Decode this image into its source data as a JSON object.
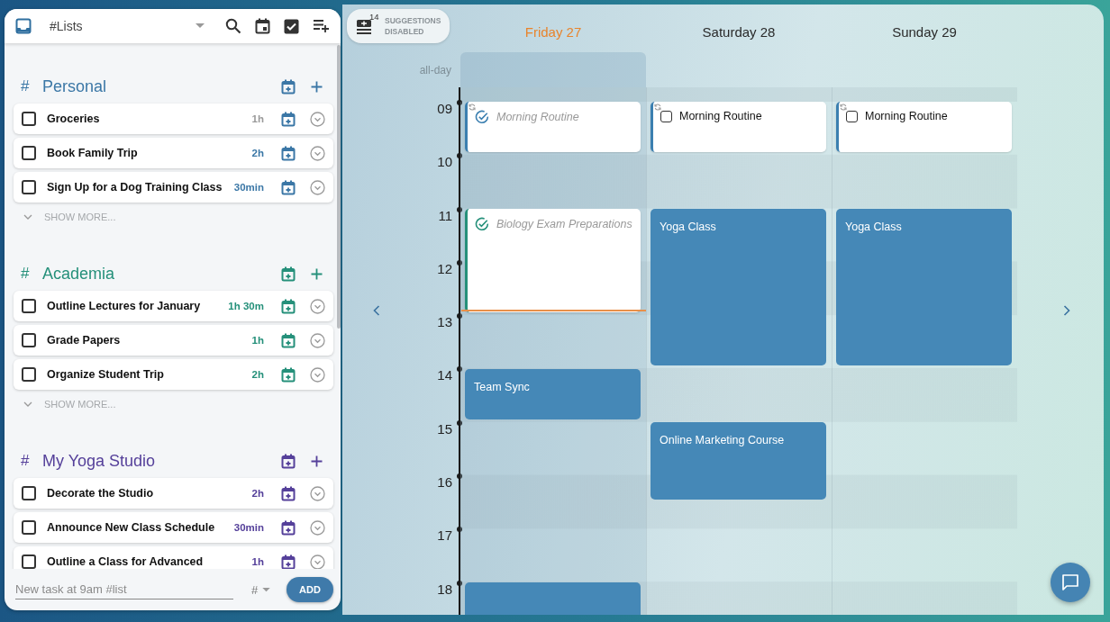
{
  "list_panel": {
    "title": "#Lists",
    "sections": [
      {
        "marker": "#",
        "name": "Personal",
        "color": "#3b77a6",
        "show_more": "SHOW MORE...",
        "tasks": [
          {
            "title": "Groceries",
            "duration": "1h",
            "duration_muted": true,
            "checked": false
          },
          {
            "title": "Book Family Trip",
            "duration": "2h",
            "duration_muted": false,
            "checked": false
          },
          {
            "title": "Sign Up for a Dog Training Class",
            "duration": "30min",
            "duration_muted": false,
            "checked": false
          }
        ]
      },
      {
        "marker": "#",
        "name": "Academia",
        "color": "#25907a",
        "show_more": "SHOW MORE...",
        "tasks": [
          {
            "title": "Outline Lectures for January",
            "duration": "1h 30m",
            "duration_muted": false,
            "checked": false
          },
          {
            "title": "Grade Papers",
            "duration": "1h",
            "duration_muted": false,
            "checked": false
          },
          {
            "title": "Organize Student Trip",
            "duration": "2h",
            "duration_muted": false,
            "checked": false
          }
        ]
      },
      {
        "marker": "#",
        "name": "My Yoga Studio",
        "color": "#55409a",
        "tasks": [
          {
            "title": "Decorate the Studio",
            "duration": "2h",
            "duration_muted": false,
            "checked": false
          },
          {
            "title": "Announce New Class Schedule",
            "duration": "30min",
            "duration_muted": false,
            "checked": false
          },
          {
            "title": "Outline a Class for Advanced",
            "duration": "1h",
            "duration_muted": false,
            "checked": false
          }
        ]
      }
    ],
    "new_task": {
      "placeholder": "New task at 9am #list",
      "list_picker": "#",
      "button": "ADD"
    }
  },
  "suggestions": {
    "count": "14",
    "label": "SUGGESTIONS DISABLED"
  },
  "calendar": {
    "allday_label": "all-day",
    "hours": [
      "09",
      "10",
      "11",
      "12",
      "13",
      "14",
      "15",
      "16",
      "17",
      "18"
    ],
    "days": [
      {
        "label": "Friday 27",
        "today": true,
        "events": [
          {
            "kind": "task",
            "title": "Morning Routine",
            "checked": true,
            "repeating": true,
            "color": "#3b7fb0"
          },
          {
            "kind": "task",
            "title": "Biology Exam Preparations",
            "checked": true,
            "repeating": false,
            "color": "#25907a"
          },
          {
            "kind": "event",
            "title": "Team Sync"
          },
          {
            "kind": "event"
          }
        ]
      },
      {
        "label": "Saturday 28",
        "today": false,
        "events": [
          {
            "kind": "task",
            "title": "Morning Routine",
            "checked": false,
            "repeating": true,
            "color": "#3b7fb0"
          },
          {
            "kind": "event",
            "title": "Yoga Class"
          },
          {
            "kind": "event",
            "title": "Online Marketing Course"
          }
        ]
      },
      {
        "label": "Sunday 29",
        "today": false,
        "events": [
          {
            "kind": "task",
            "title": "Morning Routine",
            "checked": false,
            "repeating": true,
            "color": "#3b7fb0"
          },
          {
            "kind": "event",
            "title": "Yoga Class"
          }
        ]
      }
    ]
  }
}
